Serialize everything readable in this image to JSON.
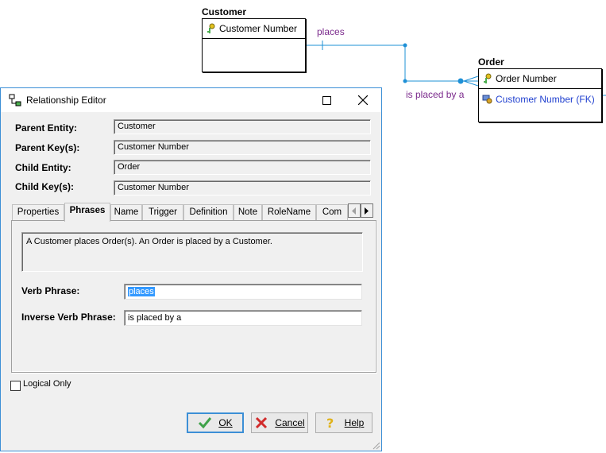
{
  "diagram": {
    "parent_entity": {
      "name": "Customer",
      "key": "Customer Number"
    },
    "child_entity": {
      "name": "Order",
      "key": "Order Number",
      "fk": "Customer Number (FK)"
    },
    "verb_phrase": "places",
    "inverse_phrase": "is placed by a",
    "line_color": "#1e90d6"
  },
  "dialog": {
    "title": "Relationship Editor",
    "fields": [
      {
        "label": "Parent Entity:",
        "value": "Customer"
      },
      {
        "label": "Parent Key(s):",
        "value": "Customer Number"
      },
      {
        "label": "Child Entity:",
        "value": "Order"
      },
      {
        "label": "Child Key(s):",
        "value": "Customer Number"
      }
    ],
    "tabs": [
      "Properties",
      "Phrases",
      "Name",
      "Trigger",
      "Definition",
      "Note",
      "RoleName",
      "Com"
    ],
    "active_tab": "Phrases",
    "description": "A Customer places Order(s).  An Order is placed by a Customer.",
    "verb_phrase_label": "Verb Phrase:",
    "verb_phrase_value": "places",
    "inverse_label": "Inverse Verb Phrase:",
    "inverse_value": "is placed by a",
    "logical_only_label": "Logical Only",
    "buttons": {
      "ok": "OK",
      "cancel": "Cancel",
      "help": "Help"
    }
  }
}
